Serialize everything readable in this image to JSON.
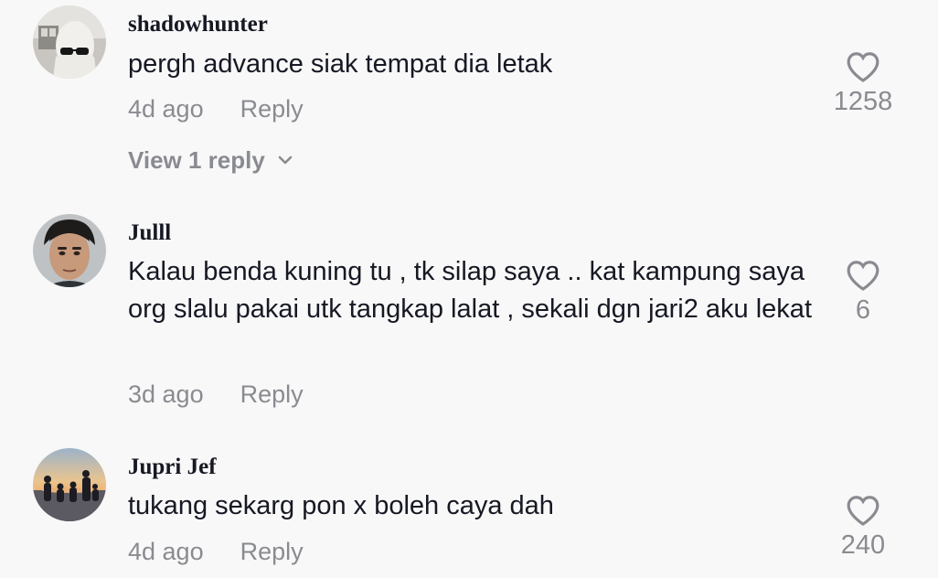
{
  "comments": [
    {
      "username": "shadowhunter",
      "text": "pergh advance siak tempat dia letak",
      "time": "4d ago",
      "reply_label": "Reply",
      "likes": "1258",
      "view_replies": "View 1 reply",
      "avatar": "masked-person-avatar"
    },
    {
      "username": "Julll",
      "text": "Kalau benda kuning tu , tk silap saya .. kat kampung saya org slalu pakai utk tangkap lalat , sekali dgn jari2 aku lekat",
      "time": "3d ago",
      "reply_label": "Reply",
      "likes": "6",
      "avatar": "man-portrait-avatar"
    },
    {
      "username": "Jupri Jef",
      "text": "tukang sekarg pon x boleh caya dah",
      "time": "4d ago",
      "reply_label": "Reply",
      "likes": "240",
      "avatar": "sunset-group-avatar"
    }
  ],
  "icons": {
    "like": "heart-outline-icon",
    "expand": "chevron-down-icon"
  },
  "colors": {
    "background": "#f8f8f8",
    "primary_text": "#161823",
    "secondary_text": "#8a8b91"
  }
}
